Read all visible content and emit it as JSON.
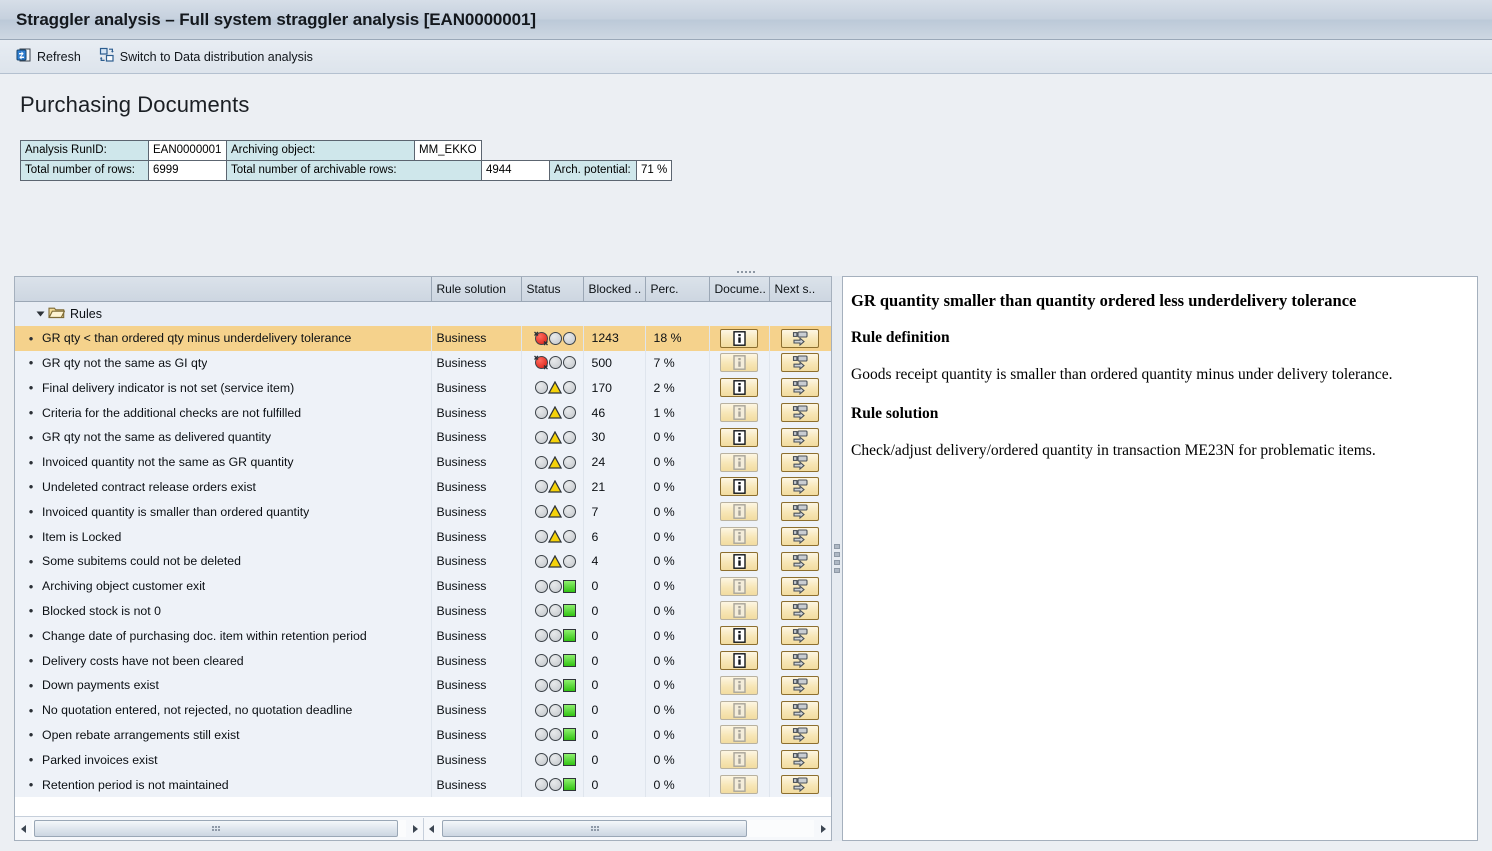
{
  "window": {
    "title": "Straggler analysis – Full system straggler analysis [EAN0000001]"
  },
  "toolbar": {
    "refresh_label": "Refresh",
    "refresh_icon": "refresh-icon",
    "switch_label": "Switch to Data distribution analysis",
    "switch_icon": "switch-view-icon"
  },
  "page": {
    "title": "Purchasing Documents"
  },
  "info": {
    "run_id_label": "Analysis RunID:",
    "run_id_value": "EAN0000001",
    "archiving_object_label": "Archiving object:",
    "archiving_object_value": "MM_EKKO",
    "total_rows_label": "Total number of rows:",
    "total_rows_value": "6999",
    "archivable_rows_label": "Total number of archivable rows:",
    "archivable_rows_value": "4944",
    "potential_label": "Arch. potential:",
    "potential_value": "71 %"
  },
  "grid": {
    "columns": [
      {
        "key": "desc",
        "label": ""
      },
      {
        "key": "solution",
        "label": "Rule solution"
      },
      {
        "key": "status",
        "label": "Status"
      },
      {
        "key": "blocked",
        "label": "Blocked .."
      },
      {
        "key": "perc",
        "label": "Perc."
      },
      {
        "key": "document",
        "label": "Docume.."
      },
      {
        "key": "nextstep",
        "label": "Next s.."
      }
    ],
    "tree_node": {
      "label": "Rules",
      "icon": "folder-open-icon",
      "expander_icon": "chevron-down-icon",
      "expanded": true
    },
    "rows": [
      {
        "desc": "GR qty < than ordered qty minus underdelivery tolerance",
        "solution": "Business",
        "status": "red",
        "blocked": "1243",
        "perc": "18 %",
        "doc_enabled": true,
        "selected": true
      },
      {
        "desc": "GR qty not the same as GI qty",
        "solution": "Business",
        "status": "red",
        "blocked": "500",
        "perc": "7 %",
        "doc_enabled": false,
        "selected": false
      },
      {
        "desc": "Final delivery indicator is not set (service item)",
        "solution": "Business",
        "status": "yellow",
        "blocked": "170",
        "perc": "2 %",
        "doc_enabled": true,
        "selected": false
      },
      {
        "desc": "Criteria for the additional checks are not fulfilled",
        "solution": "Business",
        "status": "yellow",
        "blocked": "46",
        "perc": "1 %",
        "doc_enabled": false,
        "selected": false
      },
      {
        "desc": "GR qty not the same as delivered quantity",
        "solution": "Business",
        "status": "yellow",
        "blocked": "30",
        "perc": "0 %",
        "doc_enabled": true,
        "selected": false
      },
      {
        "desc": "Invoiced quantity not the same as GR quantity",
        "solution": "Business",
        "status": "yellow",
        "blocked": "24",
        "perc": "0 %",
        "doc_enabled": false,
        "selected": false
      },
      {
        "desc": "Undeleted contract release orders exist",
        "solution": "Business",
        "status": "yellow",
        "blocked": "21",
        "perc": "0 %",
        "doc_enabled": true,
        "selected": false
      },
      {
        "desc": "Invoiced quantity is smaller than ordered quantity",
        "solution": "Business",
        "status": "yellow",
        "blocked": "7",
        "perc": "0 %",
        "doc_enabled": false,
        "selected": false
      },
      {
        "desc": "Item is Locked",
        "solution": "Business",
        "status": "yellow",
        "blocked": "6",
        "perc": "0 %",
        "doc_enabled": false,
        "selected": false
      },
      {
        "desc": "Some subitems could not be deleted",
        "solution": "Business",
        "status": "yellow",
        "blocked": "4",
        "perc": "0 %",
        "doc_enabled": true,
        "selected": false
      },
      {
        "desc": "Archiving object customer exit",
        "solution": "Business",
        "status": "green",
        "blocked": "0",
        "perc": "0 %",
        "doc_enabled": false,
        "selected": false
      },
      {
        "desc": "Blocked stock is not 0",
        "solution": "Business",
        "status": "green",
        "blocked": "0",
        "perc": "0 %",
        "doc_enabled": false,
        "selected": false
      },
      {
        "desc": "Change date of purchasing doc. item within retention period",
        "solution": "Business",
        "status": "green",
        "blocked": "0",
        "perc": "0 %",
        "doc_enabled": true,
        "selected": false
      },
      {
        "desc": "Delivery costs have not been cleared",
        "solution": "Business",
        "status": "green",
        "blocked": "0",
        "perc": "0 %",
        "doc_enabled": true,
        "selected": false
      },
      {
        "desc": "Down payments exist",
        "solution": "Business",
        "status": "green",
        "blocked": "0",
        "perc": "0 %",
        "doc_enabled": false,
        "selected": false
      },
      {
        "desc": "No quotation entered, not rejected, no quotation deadline",
        "solution": "Business",
        "status": "green",
        "blocked": "0",
        "perc": "0 %",
        "doc_enabled": false,
        "selected": false
      },
      {
        "desc": "Open rebate arrangements still exist",
        "solution": "Business",
        "status": "green",
        "blocked": "0",
        "perc": "0 %",
        "doc_enabled": false,
        "selected": false
      },
      {
        "desc": "Parked invoices exist",
        "solution": "Business",
        "status": "green",
        "blocked": "0",
        "perc": "0 %",
        "doc_enabled": false,
        "selected": false
      },
      {
        "desc": "Retention period is not maintained",
        "solution": "Business",
        "status": "green",
        "blocked": "0",
        "perc": "0 %",
        "doc_enabled": false,
        "selected": false
      }
    ],
    "icons": {
      "document_icon": "info-document-icon",
      "nextstep_icon": "next-step-icon"
    }
  },
  "detail": {
    "heading": "GR quantity smaller than quantity ordered less underdelivery tolerance",
    "definition_heading": "Rule definition",
    "definition_text": "Goods receipt quantity is smaller than ordered quantity minus under delivery tolerance.",
    "solution_heading": "Rule solution",
    "solution_text": "Check/adjust delivery/ordered quantity in transaction ME23N for problematic items."
  },
  "scrollbars": {
    "left_h": {
      "left_arrow": "scroll-left-arrow",
      "right_arrow": "scroll-right-arrow"
    },
    "right_h": {
      "left_arrow": "scroll-left-arrow",
      "right_arrow": "scroll-right-arrow"
    }
  },
  "colors": {
    "selected_row": "#f5d28c",
    "row_bg": "#eef2f8",
    "header_bg": "#cdd6e1",
    "info_label_bg": "#cfe7eb",
    "status_red": "#d81b10",
    "status_yellow": "#f5d20a",
    "status_green": "#33c414",
    "page_bg": "#eceff3"
  }
}
